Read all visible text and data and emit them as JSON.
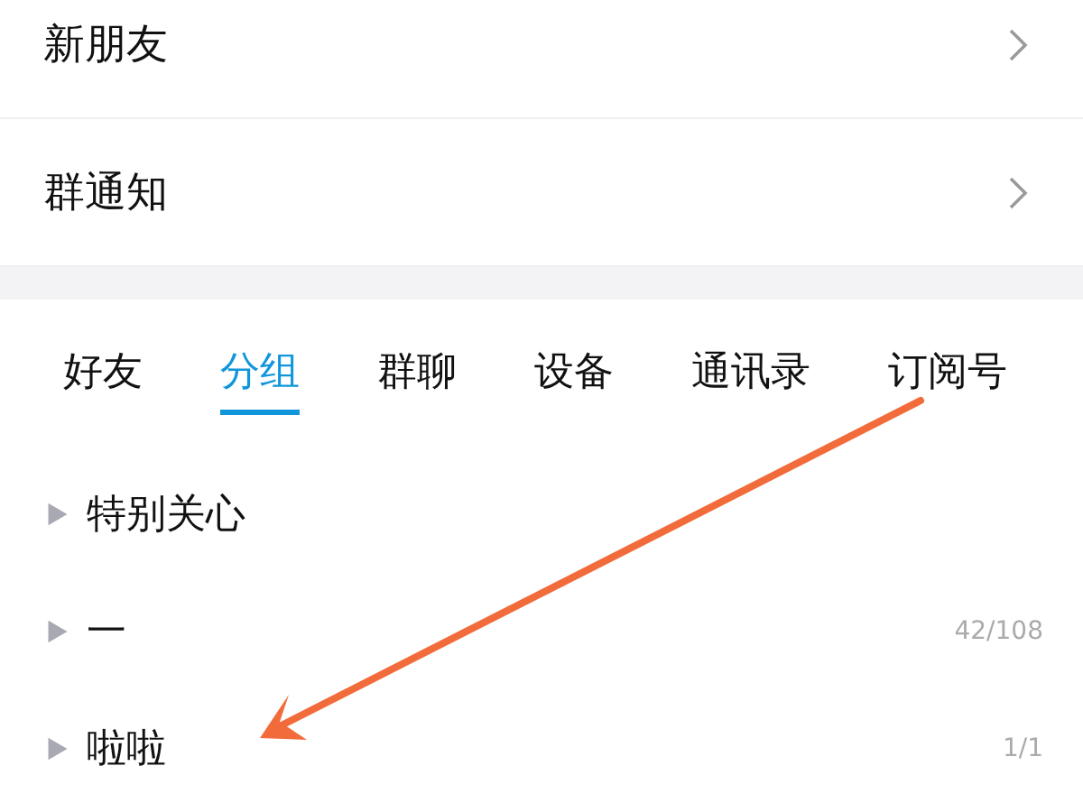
{
  "menu_items": [
    {
      "label": "新朋友"
    },
    {
      "label": "群通知"
    }
  ],
  "tabs": [
    {
      "label": "好友",
      "selected": false
    },
    {
      "label": "分组",
      "selected": true
    },
    {
      "label": "群聊",
      "selected": false
    },
    {
      "label": "设备",
      "selected": false
    },
    {
      "label": "通讯录",
      "selected": false
    },
    {
      "label": "订阅号",
      "selected": false
    }
  ],
  "groups": [
    {
      "name": "特别关心",
      "expanded": false
    },
    {
      "name": "一",
      "count": "42/108",
      "expanded": false
    },
    {
      "name": "啦啦",
      "count": "1/1",
      "expanded": false
    }
  ],
  "annotation": {
    "kind": "arrow"
  }
}
